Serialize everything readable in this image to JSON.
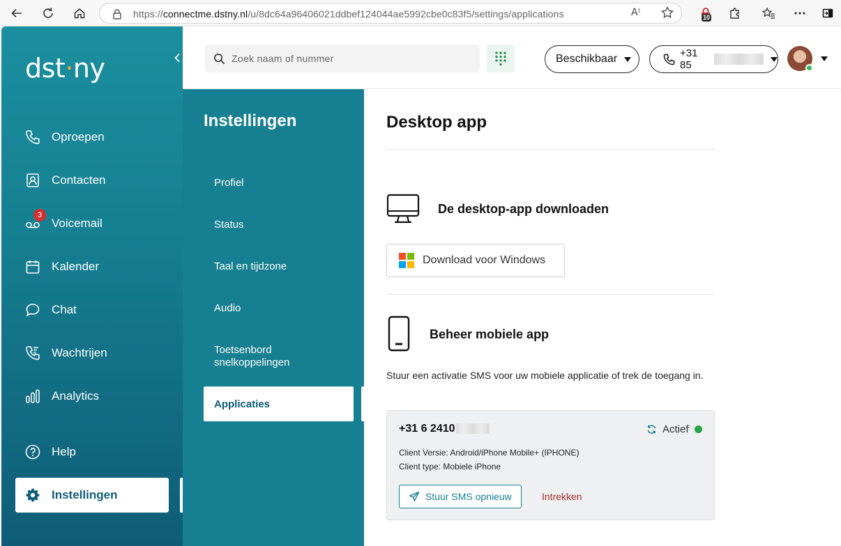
{
  "browser": {
    "url_prefix": "https://",
    "url_host": "connectme.dstny.nl",
    "url_path": "/u/8dc64a96406021ddbef124044ae5992cbe0c83f5/settings/applications",
    "read_aloud": "A⁾",
    "extension_badge": "10"
  },
  "nav": {
    "logo_pre": "dst",
    "logo_dot": "·",
    "logo_post": "ny",
    "items": [
      {
        "label": "Oproepen"
      },
      {
        "label": "Contacten"
      },
      {
        "label": "Voicemail",
        "badge": "3"
      },
      {
        "label": "Kalender"
      },
      {
        "label": "Chat"
      },
      {
        "label": "Wachtrijen"
      },
      {
        "label": "Analytics"
      },
      {
        "label": "Help"
      },
      {
        "label": "Instellingen"
      }
    ]
  },
  "header": {
    "search_placeholder": "Zoek naam of nummer",
    "status_label": "Beschikbaar",
    "phone_prefix": "+31 85"
  },
  "settings": {
    "title": "Instellingen",
    "items": [
      {
        "label": "Profiel"
      },
      {
        "label": "Status"
      },
      {
        "label": "Taal en tijdzone"
      },
      {
        "label": "Audio"
      },
      {
        "label": "Toetsenbord snelkoppelingen"
      },
      {
        "label": "Applicaties"
      }
    ]
  },
  "main": {
    "title": "Desktop app",
    "desktop_section": "De desktop-app downloaden",
    "download_button": "Download voor Windows",
    "mobile_section": "Beheer mobiele app",
    "description": "Stuur een activatie SMS voor uw mobiele applicatie of trek de toegang in.",
    "device": {
      "number_prefix": "+31 6 2410",
      "status": "Actief",
      "client_version": "Client Versie: Android/iPhone Mobile+ (IPHONE)",
      "client_type": "Client type: Mobiele iPhone",
      "resend_button": "Stuur SMS opnieuw",
      "revoke_link": "Intrekken"
    }
  },
  "colors": {
    "brand_teal": "#167f92",
    "brand_dark": "#0e5c78",
    "logo_dot": "#f0a64a",
    "active_green": "#27a84a",
    "revoke_red": "#b02a2a",
    "badge_red": "#d32f2f"
  }
}
